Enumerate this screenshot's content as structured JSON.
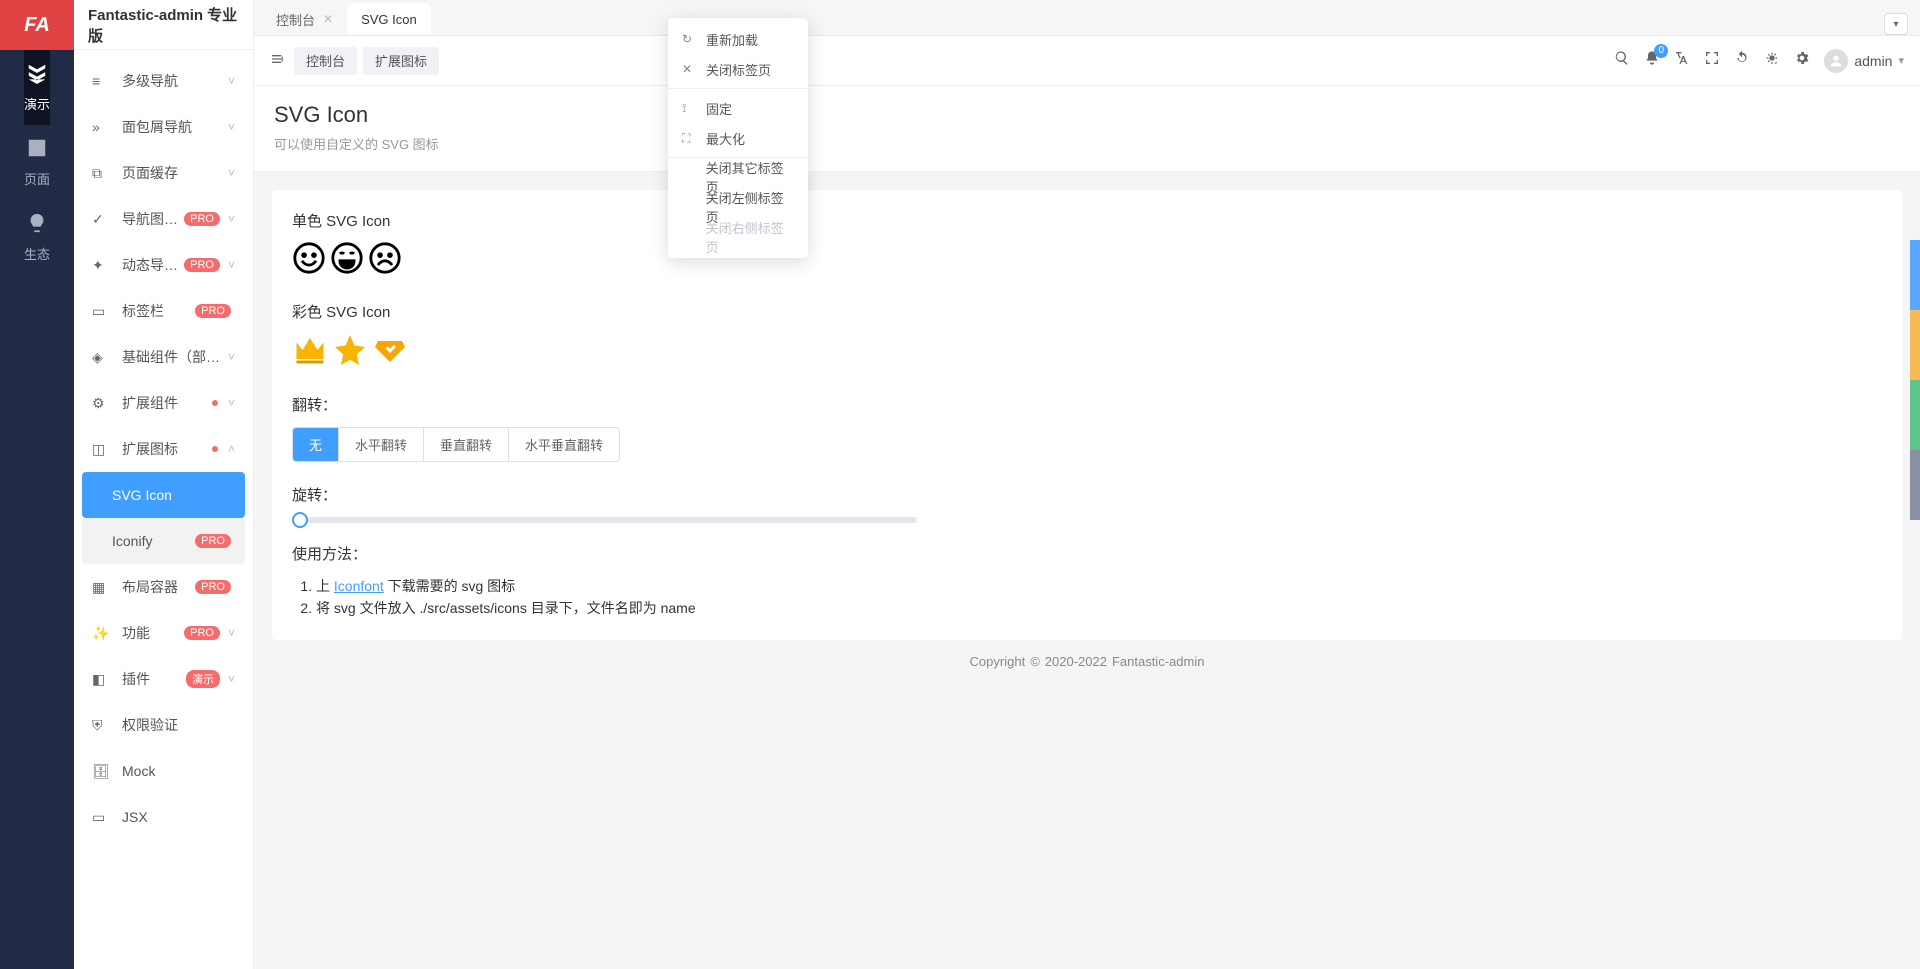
{
  "logo": "FA",
  "app_title": "Fantastic-admin 专业版",
  "main_nav": [
    {
      "label": "演示",
      "active": true
    },
    {
      "label": "页面",
      "active": false
    },
    {
      "label": "生态",
      "active": false
    }
  ],
  "sub_menu": [
    {
      "label": "多级导航",
      "expand": true
    },
    {
      "label": "面包屑导航",
      "expand": true
    },
    {
      "label": "页面缓存",
      "expand": true
    },
    {
      "label": "导航图标激",
      "badge": "PRO",
      "expand": true
    },
    {
      "label": "动态导航标",
      "badge": "PRO",
      "expand": true
    },
    {
      "label": "标签栏",
      "badge": "PRO"
    },
    {
      "label": "基础组件（部分…",
      "expand": true
    },
    {
      "label": "扩展组件",
      "dot": true,
      "expand": true
    },
    {
      "label": "扩展图标",
      "dot": true,
      "expand": true,
      "open": true,
      "children": [
        {
          "label": "SVG Icon",
          "active": true
        },
        {
          "label": "Iconify",
          "badge": "PRO",
          "sel": true
        }
      ]
    },
    {
      "label": "布局容器",
      "badge": "PRO"
    },
    {
      "label": "功能",
      "badge": "PRO",
      "expand": true
    },
    {
      "label": "插件",
      "badge_demo": "演示",
      "expand": true
    },
    {
      "label": "权限验证"
    },
    {
      "label": "Mock"
    },
    {
      "label": "JSX"
    }
  ],
  "tabs": [
    {
      "label": "控制台",
      "closable": true
    },
    {
      "label": "SVG Icon",
      "active": true
    }
  ],
  "tabbar_more": "▾",
  "breadcrumbs": [
    "控制台",
    "扩展图标"
  ],
  "toolbar_bell_count": "0",
  "user_name": "admin",
  "page": {
    "title": "SVG Icon",
    "desc": "可以使用自定义的 SVG 图标"
  },
  "sections": {
    "mono": "单色 SVG Icon",
    "color": "彩色 SVG Icon",
    "flip": "翻转：",
    "rotate": "旋转：",
    "usage": "使用方法："
  },
  "flip_options": [
    "无",
    "水平翻转",
    "垂直翻转",
    "水平垂直翻转"
  ],
  "usage_steps": {
    "step1_a": "上 ",
    "step1_link": "Iconfont",
    "step1_b": " 下载需要的 svg 图标",
    "step2": "将 svg 文件放入 ./src/assets/icons 目录下，文件名即为 name"
  },
  "footer": {
    "copyright": "Copyright",
    "years": "2020-2022",
    "brand": "Fantastic-admin"
  },
  "ctx_menu": {
    "g1": [
      {
        "icon": "reload",
        "label": "重新加载"
      },
      {
        "icon": "close",
        "label": "关闭标签页"
      }
    ],
    "g2": [
      {
        "icon": "pin",
        "label": "固定"
      },
      {
        "icon": "max",
        "label": "最大化"
      }
    ],
    "g3": [
      {
        "label": "关闭其它标签页"
      },
      {
        "label": "关闭左侧标签页"
      },
      {
        "label": "关闭右侧标签页",
        "disabled": true
      }
    ]
  },
  "strips": [
    "#5aa7ff",
    "#f7b955",
    "#5fc58e",
    "#8a8fa3"
  ]
}
